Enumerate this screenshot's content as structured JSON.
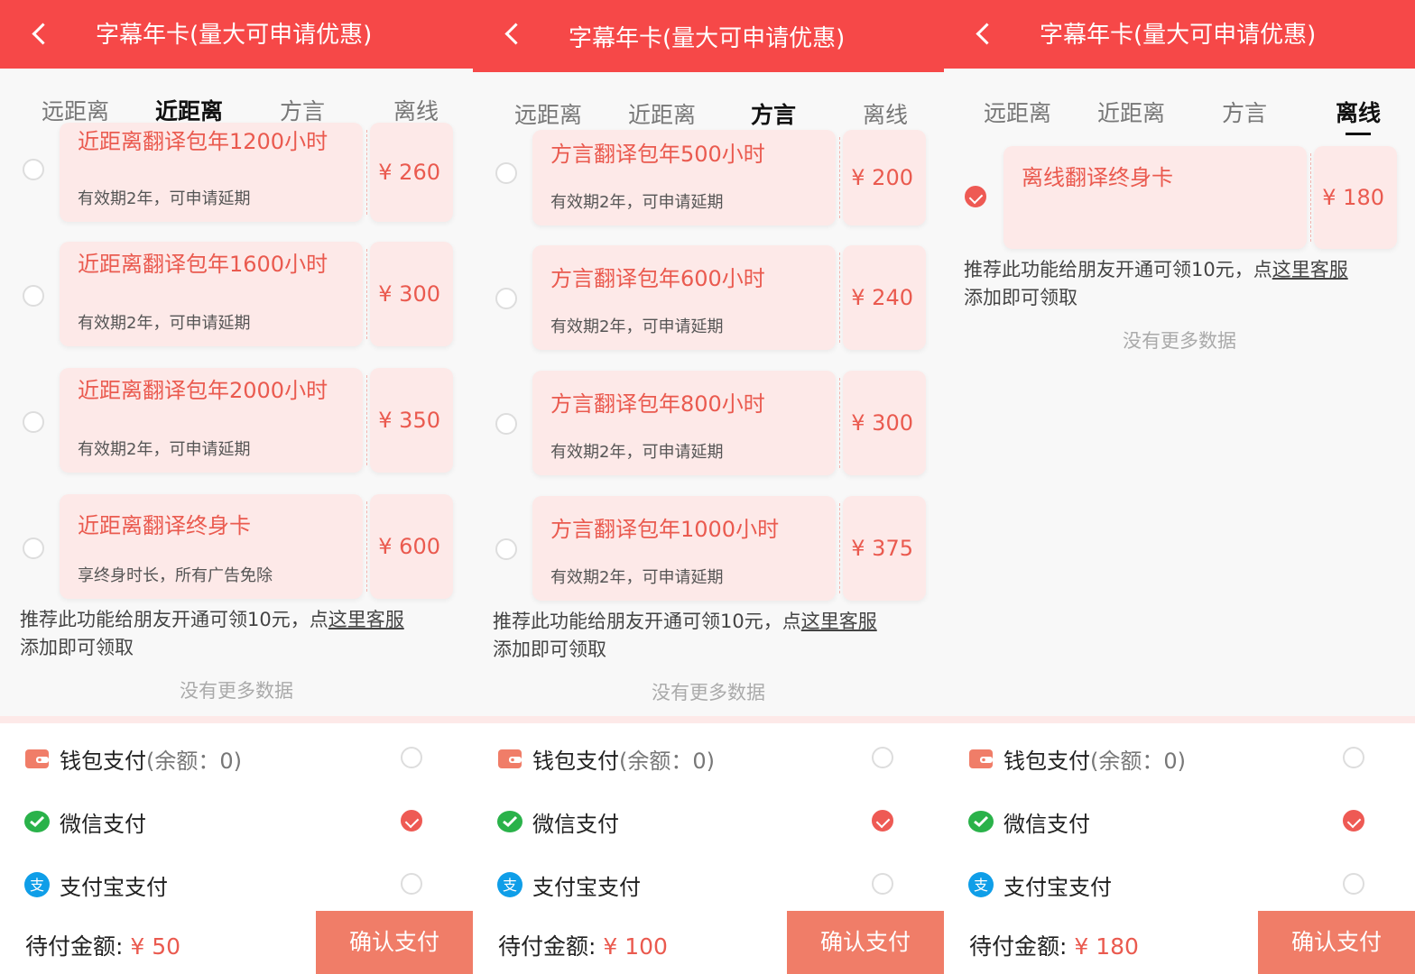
{
  "screens": [
    {
      "title": "字幕年卡(量大可申请优惠)",
      "tabs": [
        "远距离",
        "近距离",
        "方言",
        "离线"
      ],
      "active_tab": "近距离",
      "packages": [
        {
          "name": "近距离翻译包年1200小时",
          "desc": "有效期2年，可申请延期",
          "price": "¥ 260",
          "selected": false
        },
        {
          "name": "近距离翻译包年1600小时",
          "desc": "有效期2年，可申请延期",
          "price": "¥ 300",
          "selected": false
        },
        {
          "name": "近距离翻译包年2000小时",
          "desc": "有效期2年，可申请延期",
          "price": "¥ 350",
          "selected": false
        },
        {
          "name": "近距离翻译终身卡",
          "desc": "享终身时长，所有广告免除",
          "price": "¥ 600",
          "selected": false
        }
      ],
      "promo_text": "推荐此功能给朋友开通可领10元，点",
      "promo_link": "这里客服",
      "promo_tail": "添加即可领取",
      "no_more": "没有更多数据",
      "payments": [
        {
          "icon": "wallet-icon",
          "label": "钱包支付",
          "sub": "(余额：0)",
          "selected": false
        },
        {
          "icon": "wechat-pay-icon",
          "label": "微信支付",
          "sub": "",
          "selected": true
        },
        {
          "icon": "alipay-icon",
          "label": "支付宝支付",
          "sub": "",
          "selected": false
        }
      ],
      "amount_label": "待付金额:",
      "amount_value": "¥ 50",
      "confirm_label": "确认支付"
    },
    {
      "title": "字幕年卡(量大可申请优惠)",
      "tabs": [
        "远距离",
        "近距离",
        "方言",
        "离线"
      ],
      "active_tab": "方言",
      "packages": [
        {
          "name": "方言翻译包年500小时",
          "desc": "有效期2年，可申请延期",
          "price": "¥ 200",
          "selected": false
        },
        {
          "name": "方言翻译包年600小时",
          "desc": "有效期2年，可申请延期",
          "price": "¥ 240",
          "selected": false
        },
        {
          "name": "方言翻译包年800小时",
          "desc": "有效期2年，可申请延期",
          "price": "¥ 300",
          "selected": false
        },
        {
          "name": "方言翻译包年1000小时",
          "desc": "有效期2年，可申请延期",
          "price": "¥ 375",
          "selected": false
        }
      ],
      "promo_text": "推荐此功能给朋友开通可领10元，点",
      "promo_link": "这里客服",
      "promo_tail": "添加即可领取",
      "no_more": "没有更多数据",
      "payments": [
        {
          "icon": "wallet-icon",
          "label": "钱包支付",
          "sub": "(余额：0)",
          "selected": false
        },
        {
          "icon": "wechat-pay-icon",
          "label": "微信支付",
          "sub": "",
          "selected": true
        },
        {
          "icon": "alipay-icon",
          "label": "支付宝支付",
          "sub": "",
          "selected": false
        }
      ],
      "amount_label": "待付金额:",
      "amount_value": "¥ 100",
      "confirm_label": "确认支付"
    },
    {
      "title": "字幕年卡(量大可申请优惠)",
      "tabs": [
        "远距离",
        "近距离",
        "方言",
        "离线"
      ],
      "active_tab": "离线",
      "packages": [
        {
          "name": "离线翻译终身卡",
          "desc": "",
          "price": "¥ 180",
          "selected": true
        }
      ],
      "promo_text": "推荐此功能给朋友开通可领10元，点",
      "promo_link": "这里客服",
      "promo_tail": "添加即可领取",
      "no_more": "没有更多数据",
      "payments": [
        {
          "icon": "wallet-icon",
          "label": "钱包支付",
          "sub": "(余额：0)",
          "selected": false
        },
        {
          "icon": "wechat-pay-icon",
          "label": "微信支付",
          "sub": "",
          "selected": true
        },
        {
          "icon": "alipay-icon",
          "label": "支付宝支付",
          "sub": "",
          "selected": false
        }
      ],
      "amount_label": "待付金额:",
      "amount_value": "¥ 180",
      "confirm_label": "确认支付"
    }
  ]
}
